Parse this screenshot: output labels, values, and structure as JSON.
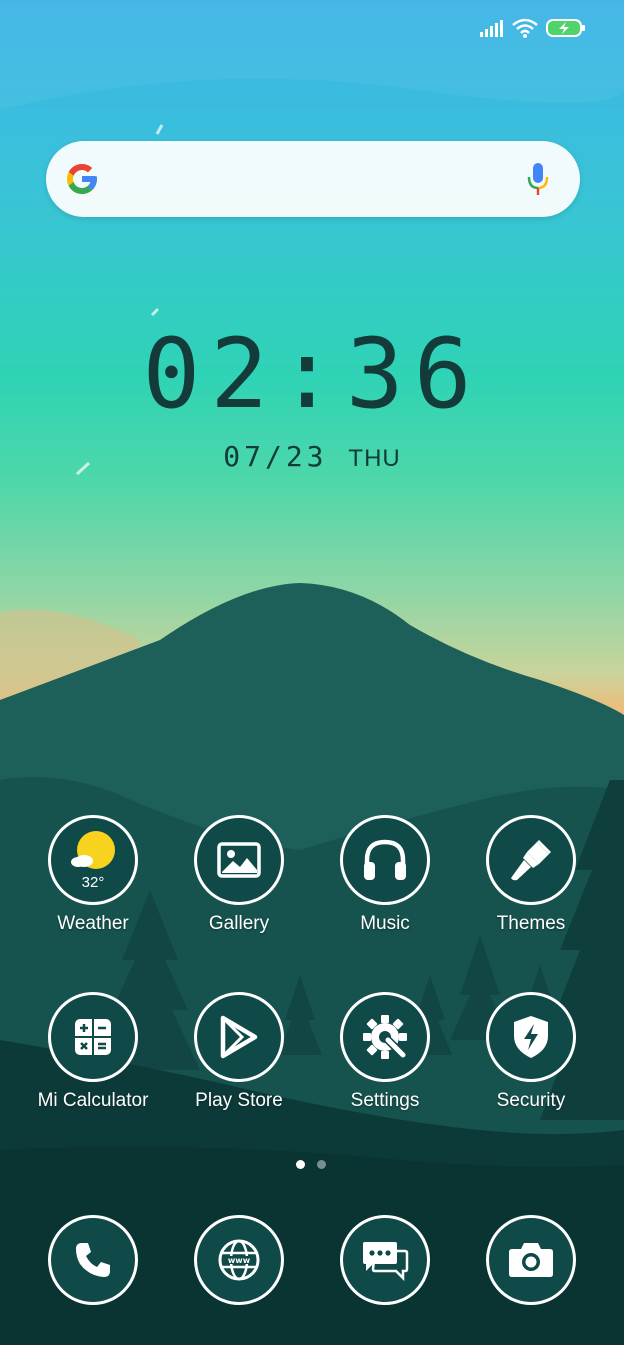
{
  "status_bar": {
    "icons": [
      "signal-icon",
      "wifi-icon",
      "battery-charging-icon"
    ]
  },
  "search": {
    "logo": "google-logo",
    "voice_icon": "microphone-icon",
    "colors": {
      "blue": "#4285F4",
      "red": "#EA4335",
      "yellow": "#FBBC05",
      "green": "#34A853"
    }
  },
  "clock": {
    "time": "02:36",
    "date": "07/23",
    "weekday": "THU"
  },
  "apps": [
    {
      "id": "weather",
      "label": "Weather",
      "icon": "sun-cloud-icon",
      "badge": "32°"
    },
    {
      "id": "gallery",
      "label": "Gallery",
      "icon": "image-icon"
    },
    {
      "id": "music",
      "label": "Music",
      "icon": "headphones-icon"
    },
    {
      "id": "themes",
      "label": "Themes",
      "icon": "paintbrush-icon"
    },
    {
      "id": "calculator",
      "label": "Mi Calculator",
      "icon": "calculator-icon"
    },
    {
      "id": "playstore",
      "label": "Play Store",
      "icon": "play-icon"
    },
    {
      "id": "settings",
      "label": "Settings",
      "icon": "gear-wrench-icon"
    },
    {
      "id": "security",
      "label": "Security",
      "icon": "shield-bolt-icon"
    }
  ],
  "pager": {
    "pages": 2,
    "current": 1
  },
  "dock": [
    {
      "id": "phone",
      "icon": "phone-icon"
    },
    {
      "id": "browser",
      "icon": "globe-icon"
    },
    {
      "id": "messages",
      "icon": "chat-icon"
    },
    {
      "id": "camera",
      "icon": "camera-icon"
    }
  ],
  "theme": {
    "icon_bg": "#0f4a48",
    "clock_color": "#123b3a",
    "sun_color": "#f7d21e"
  }
}
